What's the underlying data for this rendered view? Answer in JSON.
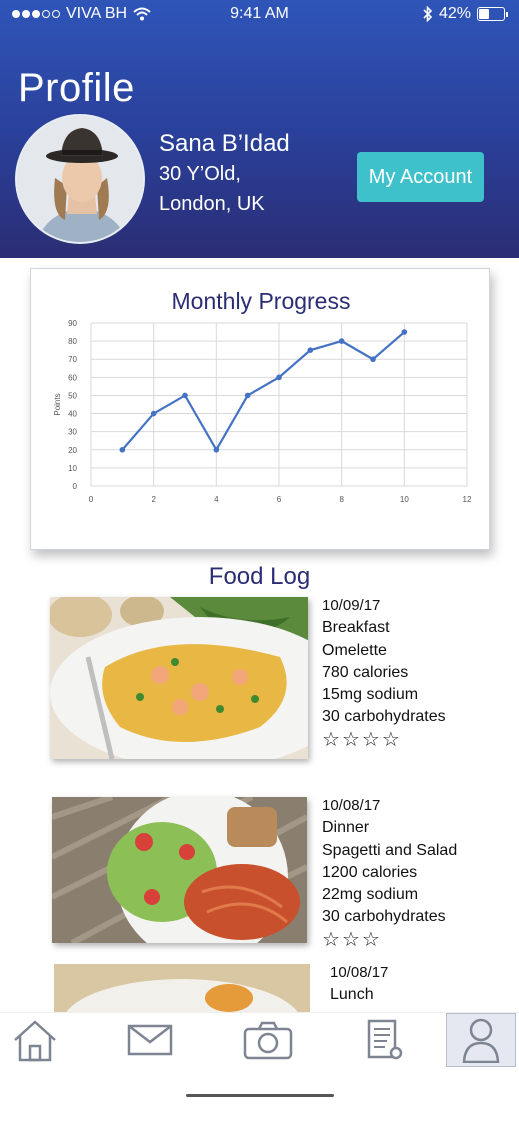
{
  "status_bar": {
    "carrier": "VIVA BH",
    "time": "9:41 AM",
    "battery": "42%",
    "battery_level": 0.42
  },
  "header": {
    "title": "Profile",
    "user_name": "Sana B’Idad",
    "age": "30 Y’Old,",
    "location": "London, UK",
    "account_button": "My Account"
  },
  "colors": {
    "header_top": "#2f55b9",
    "header_bottom": "#2b2d74",
    "accent": "#3fc1cb",
    "line": "#4472c4",
    "title": "#2b2d74"
  },
  "chart_data": {
    "type": "line",
    "title": "Monthly Progress",
    "xlabel": "",
    "ylabel": "Points",
    "xlim": [
      0,
      12
    ],
    "ylim": [
      0,
      90
    ],
    "xticks": [
      0,
      2,
      4,
      6,
      8,
      10,
      12
    ],
    "yticks": [
      0,
      10,
      20,
      30,
      40,
      50,
      60,
      70,
      80,
      90
    ],
    "grid": true,
    "series": [
      {
        "x": [
          1,
          2,
          3,
          4,
          5,
          6,
          7,
          8,
          9,
          10
        ],
        "values": [
          20,
          40,
          50,
          20,
          50,
          60,
          75,
          80,
          70,
          85
        ]
      }
    ]
  },
  "food_log": {
    "title": "Food Log",
    "entries": [
      {
        "date": "10/09/17",
        "meal": "Breakfast",
        "dish": "Omelette",
        "calories": "780 calories",
        "sodium": "15mg sodium",
        "carbs": "30 carbohydrates",
        "rating": 4
      },
      {
        "date": "10/08/17",
        "meal": "Dinner",
        "dish": "Spagetti and Salad",
        "calories": "1200 calories",
        "sodium": "22mg sodium",
        "carbs": "30 carbohydrates",
        "rating": 3
      },
      {
        "date": "10/08/17",
        "meal": "Lunch"
      }
    ]
  },
  "tabs": [
    {
      "name": "home",
      "icon": "home-icon"
    },
    {
      "name": "messages",
      "icon": "mail-icon"
    },
    {
      "name": "camera",
      "icon": "camera-icon"
    },
    {
      "name": "log",
      "icon": "document-icon"
    },
    {
      "name": "profile",
      "icon": "user-icon",
      "active": true
    }
  ]
}
